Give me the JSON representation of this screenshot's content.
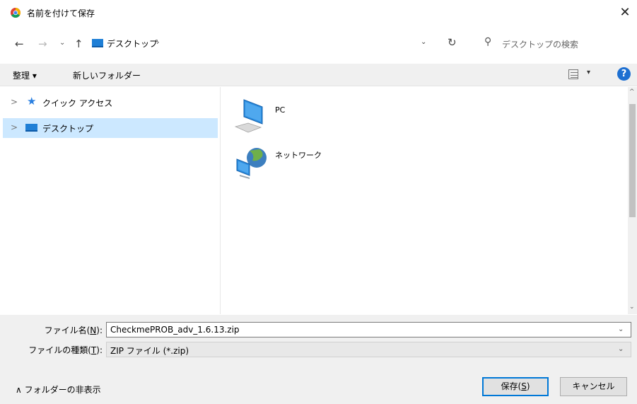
{
  "window": {
    "title": "名前を付けて保存",
    "close_glyph": "✕"
  },
  "address_bar": {
    "back_glyph": "←",
    "forward_glyph": "→",
    "recent_glyph": "⌄",
    "up_glyph": "↑",
    "path": "デスクトップ",
    "separator": "›",
    "dropdown_glyph": "⌄",
    "refresh_glyph": "↻"
  },
  "search": {
    "placeholder": "デスクトップの検索",
    "icon_glyph": "⚲"
  },
  "toolbar": {
    "organize_label": "整理 ▾",
    "new_folder_label": "新しいフォルダー",
    "view_dropdown_glyph": "▾",
    "help_glyph": "?"
  },
  "nav_pane": {
    "items": [
      {
        "label": "クイック アクセス",
        "chevron": ">",
        "icon": "star-icon",
        "selected": false
      },
      {
        "label": "デスクトップ",
        "chevron": ">",
        "icon": "desktop-icon",
        "selected": true
      }
    ]
  },
  "content": {
    "items": [
      {
        "label": "PC",
        "icon": "computer-icon"
      },
      {
        "label": "ネットワーク",
        "icon": "network-icon"
      }
    ]
  },
  "bottom": {
    "filename_label_pre": "ファイル名(",
    "filename_label_key": "N",
    "filename_label_post": "):",
    "filename_value": "CheckmePROB_adv_1.6.13.zip",
    "filetype_label_pre": "ファイルの種類(",
    "filetype_label_key": "T",
    "filetype_label_post": "):",
    "filetype_value": "ZIP ファイル (*.zip)",
    "dropdown_glyph": "⌄",
    "hide_folders_label": "∧ フォルダーの非表示",
    "save_label_pre": "保存(",
    "save_label_key": "S",
    "save_label_post": ")",
    "cancel_label": "キャンセル"
  },
  "scrollbar": {
    "up_glyph": "^",
    "down_glyph": "⌄"
  },
  "colors": {
    "accent": "#0078d7",
    "selected_bg": "#cce8ff",
    "panel_bg": "#f0f0f0"
  }
}
